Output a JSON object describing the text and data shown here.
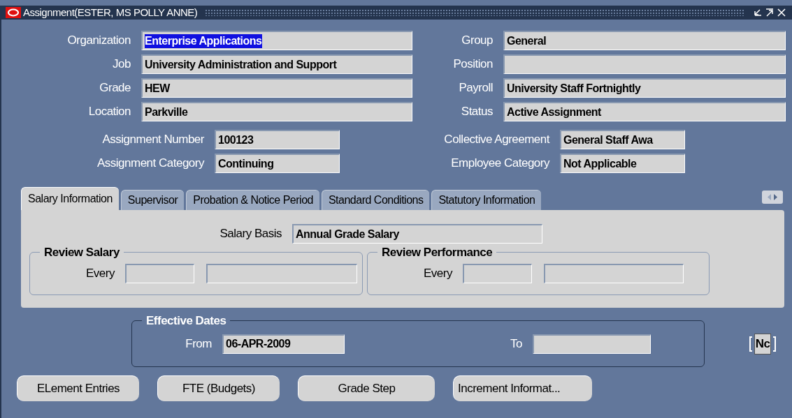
{
  "window": {
    "title": "Assignment(ESTER, MS POLLY ANNE)"
  },
  "top_fields": [
    {
      "label": "Organization",
      "value": "Enterprise Applications",
      "highlighted": true
    },
    {
      "label": "Group",
      "value": "General",
      "highlighted": false
    },
    {
      "label": "Job",
      "value": "University Administration and Support",
      "highlighted": false
    },
    {
      "label": "Position"
    },
    {
      "label": "Grade",
      "value": "HEW",
      "highlighted": false
    },
    {
      "label": "Payroll",
      "value": "University Staff Fortnightly",
      "highlighted": false
    },
    {
      "label": "Location",
      "value": "Parkville",
      "highlighted": false
    },
    {
      "label": "Status",
      "value": "Active Assignment",
      "highlighted": false
    }
  ],
  "mid_fields": [
    {
      "label": "Assignment Number",
      "value": "100123"
    },
    {
      "label": "Collective Agreement",
      "value": "General Staff Awa"
    },
    {
      "label": "Assignment Category",
      "value": "Continuing"
    },
    {
      "label": "Employee Category",
      "value": "Not Applicable"
    }
  ],
  "tabs": [
    {
      "label": "Salary Information",
      "selected": true
    },
    {
      "label": "Supervisor",
      "selected": false
    },
    {
      "label": "Probation & Notice Period",
      "selected": false
    },
    {
      "label": "Standard Conditions",
      "selected": false
    },
    {
      "label": "Statutory Information",
      "selected": false
    }
  ],
  "salary_basis": {
    "label": "Salary Basis",
    "value": "Annual Grade Salary"
  },
  "review_groups": [
    {
      "title": "Review Salary",
      "label": "Every"
    },
    {
      "title": "Review Performance",
      "label": "Every"
    }
  ],
  "effective_dates": {
    "title": "Effective Dates",
    "from_label": "From",
    "from_value": "06-APR-2009",
    "to_label": "To"
  },
  "folder_field": {
    "value": "Nc"
  },
  "buttons": [
    "ELement Entries",
    "FTE (Budgets)",
    "Grade Step",
    "Increment Informat..."
  ]
}
